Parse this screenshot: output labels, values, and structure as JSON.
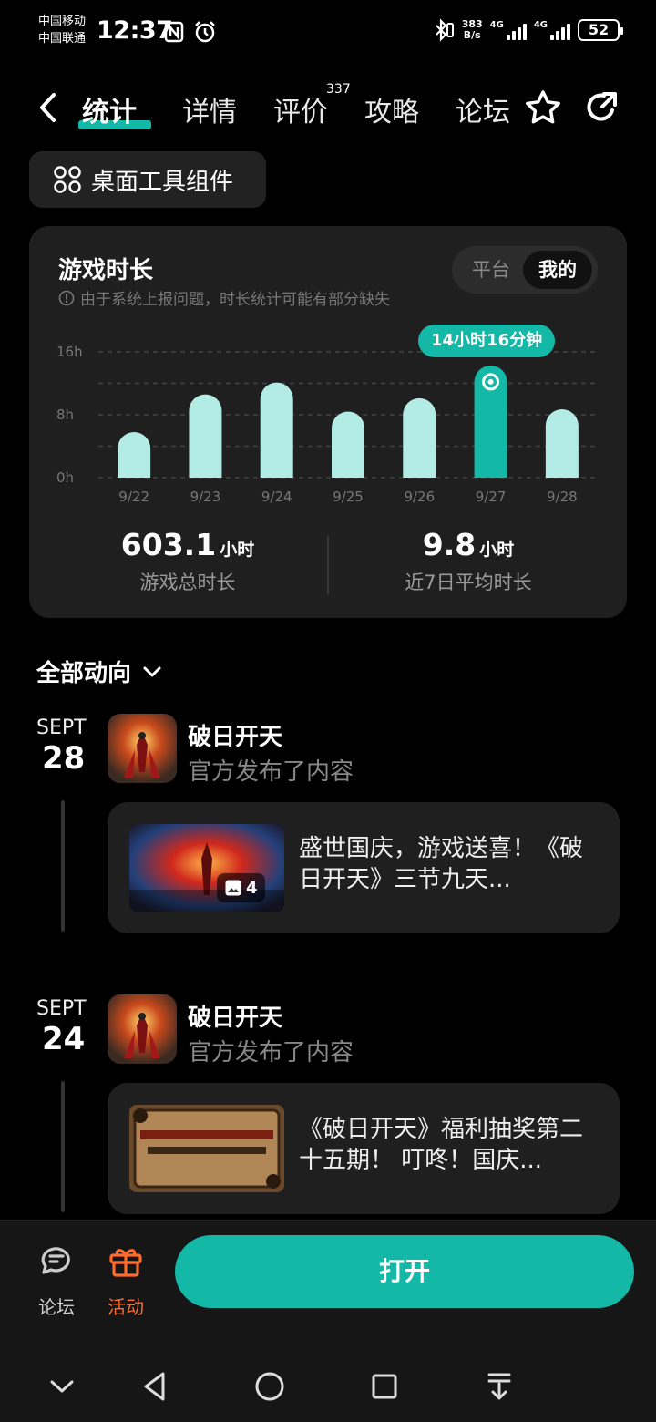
{
  "status_bar": {
    "carrier1": "中国移动",
    "carrier2": "中国联通",
    "time": "12:37",
    "net_speed_value": "383",
    "net_speed_unit": "B/s",
    "sig1": "4G",
    "sig2": "4G",
    "battery": "52"
  },
  "tabs": [
    {
      "label": "统计"
    },
    {
      "label": "详情"
    },
    {
      "label": "评价",
      "badge": "337"
    },
    {
      "label": "攻略"
    },
    {
      "label": "论坛"
    }
  ],
  "widget_button": "桌面工具组件",
  "stats_card": {
    "title": "游戏时长",
    "note": "由于系统上报问题，时长统计可能有部分缺失",
    "segment": {
      "platform": "平台",
      "mine": "我的"
    },
    "tooltip": "14小时16分钟",
    "total_value": "603.1",
    "total_unit": "小时",
    "total_label": "游戏总时长",
    "avg_value": "9.8",
    "avg_unit": "小时",
    "avg_label": "近7日平均时长"
  },
  "chart_data": {
    "type": "bar",
    "categories": [
      "9/22",
      "9/23",
      "9/24",
      "9/25",
      "9/26",
      "9/27",
      "9/28"
    ],
    "values": [
      5.8,
      10.6,
      12.1,
      8.4,
      10.1,
      14.27,
      8.7
    ],
    "selected_index": 5,
    "y_ticks": [
      "16h",
      "8h",
      "0h"
    ],
    "ylim": [
      0,
      16
    ],
    "colors": {
      "bar": "#b2ece4",
      "selected": "#14b8a6"
    }
  },
  "feed": {
    "filter": "全部动向",
    "items": [
      {
        "month": "SEPT",
        "day": "28",
        "app": "破日开天",
        "sub": "官方发布了内容",
        "text": "盛世国庆，游戏送喜！《破日开天》三节九天...",
        "image_count": "4"
      },
      {
        "month": "SEPT",
        "day": "24",
        "app": "破日开天",
        "sub": "官方发布了内容",
        "text": "《破日开天》福利抽奖第二十五期！ 叮咚！国庆..."
      }
    ]
  },
  "bottom": {
    "forum": "论坛",
    "activity": "活动",
    "open": "打开"
  },
  "accent_color": "#14b8a6"
}
